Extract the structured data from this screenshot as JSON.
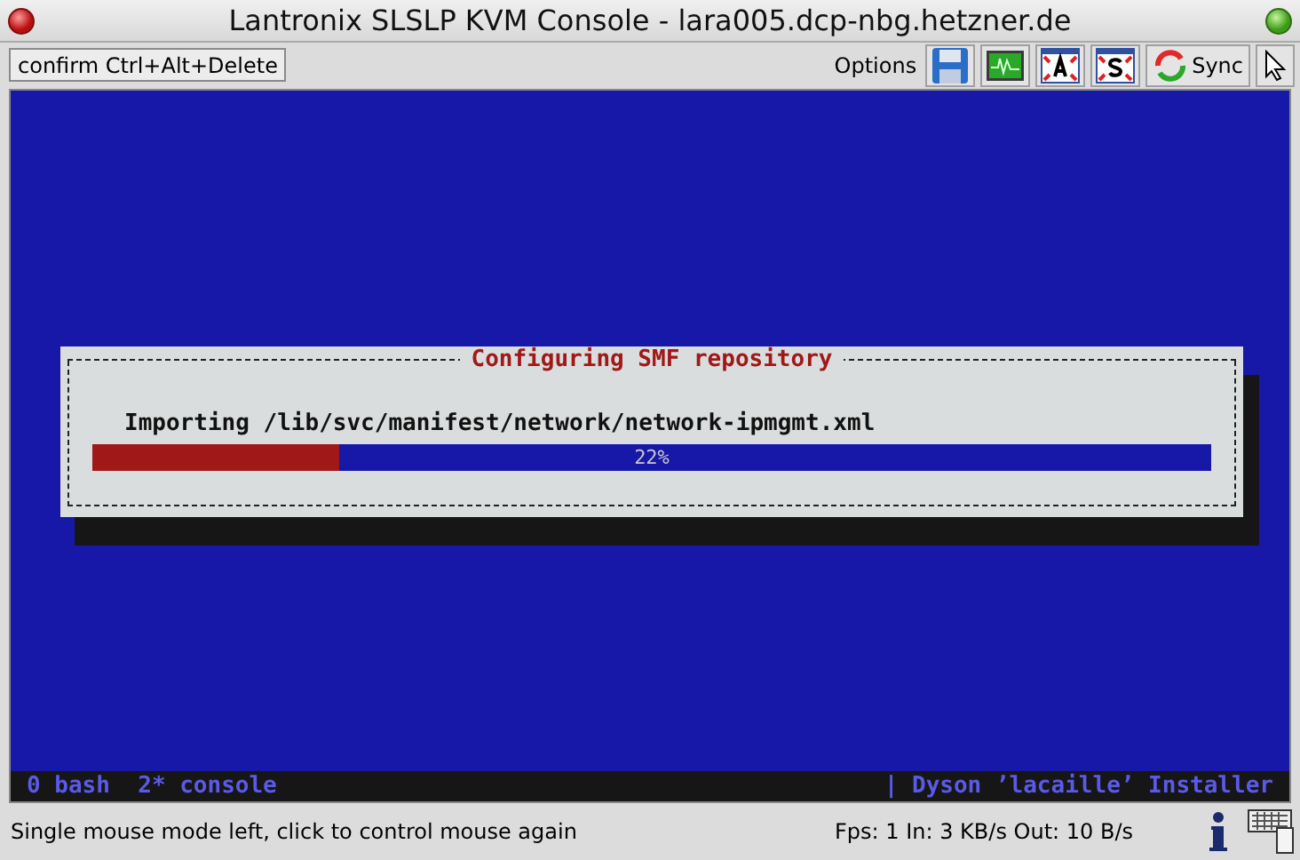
{
  "window": {
    "title": "Lantronix SLSLP KVM Console - lara005.dcp-nbg.hetzner.de"
  },
  "toolbar": {
    "confirm_button": "confirm Ctrl+Alt+Delete",
    "options_label": "Options",
    "sync_label": "Sync"
  },
  "dialog": {
    "title": "Configuring SMF repository",
    "message": "Importing /lib/svc/manifest/network/network-ipmgmt.xml",
    "progress": {
      "level": 0.22,
      "reading": "22%"
    }
  },
  "terminal_status": {
    "windows": "0 bash  2* console",
    "installer": "| Dyson ’lacaille’ Installer"
  },
  "status_bar": {
    "message": "Single mouse mode left, click to control mouse again",
    "stats": "Fps: 1 In: 3 KB/s Out: 10 B/s"
  }
}
